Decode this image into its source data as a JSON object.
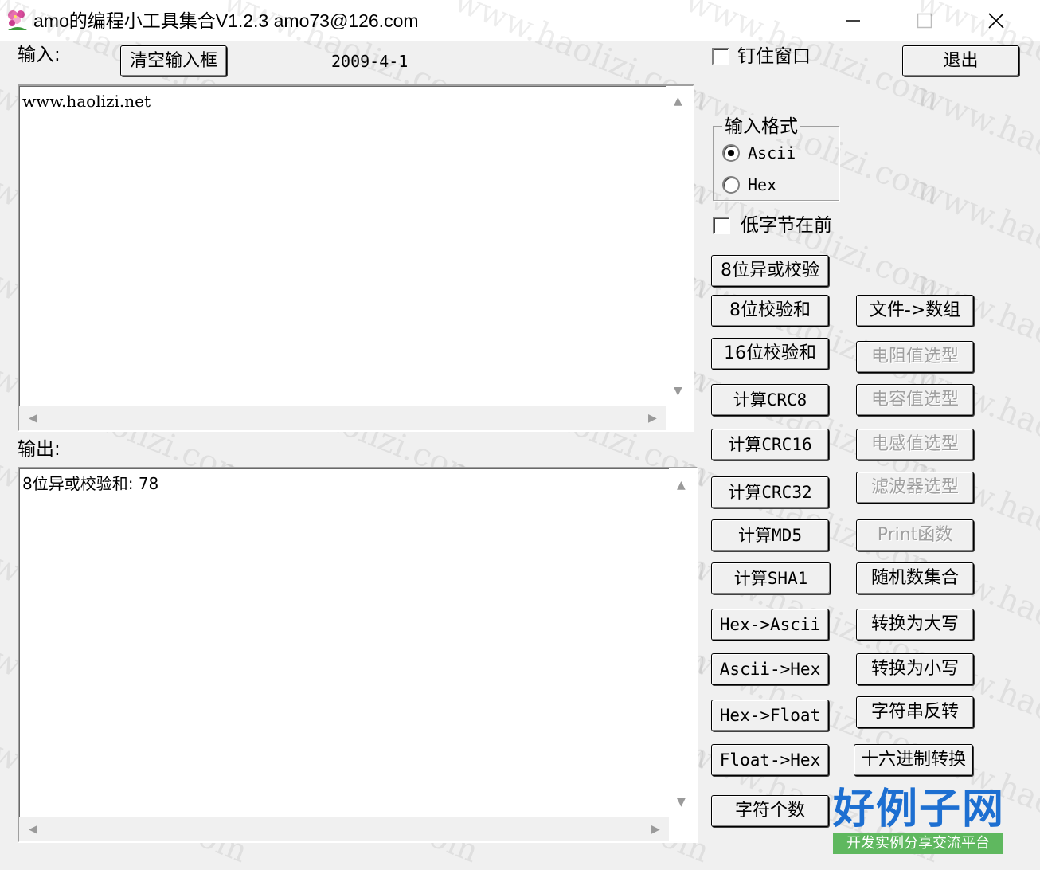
{
  "window": {
    "title": "amo的编程小工具集合V1.2.3 amo73@126.com"
  },
  "input": {
    "label": "输入:",
    "clear_button": "清空输入框",
    "date": "2009-4-1",
    "value": "www.haolizi.net"
  },
  "output": {
    "label": "输出:",
    "value": "8位异或校验和: 78"
  },
  "options": {
    "pin_window_label": "钉住窗口",
    "pin_window_checked": false,
    "exit_button": "退出",
    "input_format_title": "输入格式",
    "formats": [
      "Ascii",
      "Hex"
    ],
    "selected_format": "Ascii",
    "low_byte_first_label": "低字节在前",
    "low_byte_first_checked": false
  },
  "buttons_left": [
    "8位异或校验",
    "8位校验和",
    "16位校验和",
    "计算CRC8",
    "计算CRC16",
    "计算CRC32",
    "计算MD5",
    "计算SHA1",
    "Hex->Ascii",
    "Ascii->Hex",
    "Hex->Float",
    "Float->Hex",
    "字符个数"
  ],
  "buttons_right": [
    {
      "label": "文件->数组",
      "enabled": true
    },
    {
      "label": "电阻值选型",
      "enabled": false
    },
    {
      "label": "电容值选型",
      "enabled": false
    },
    {
      "label": "电感值选型",
      "enabled": false
    },
    {
      "label": "滤波器选型",
      "enabled": false
    },
    {
      "label": "Print函数",
      "enabled": false
    },
    {
      "label": "随机数集合",
      "enabled": true
    },
    {
      "label": "转换为大写",
      "enabled": true
    },
    {
      "label": "转换为小写",
      "enabled": true
    },
    {
      "label": "字符串反转",
      "enabled": true
    },
    {
      "label": "十六进制转换",
      "enabled": true
    }
  ],
  "watermark": {
    "text": "www.haolizi.com",
    "logo_main": "好例子网",
    "logo_sub": "开发实例分享交流平台"
  },
  "icons": [
    "app-flower-icon",
    "minimize-icon",
    "maximize-icon",
    "close-icon"
  ]
}
